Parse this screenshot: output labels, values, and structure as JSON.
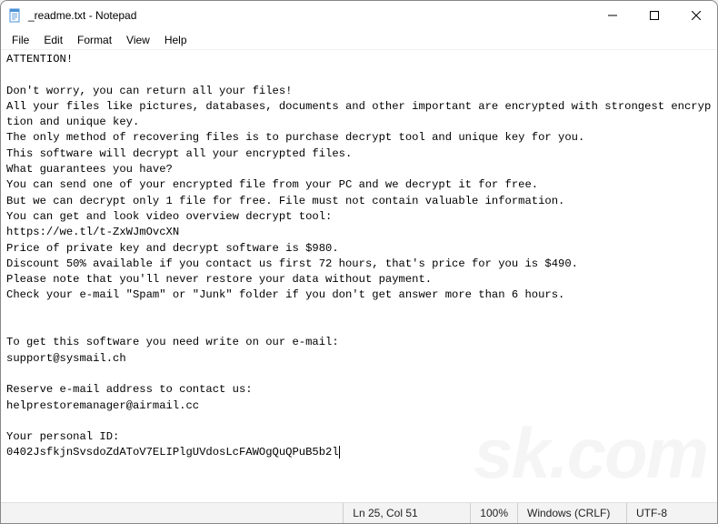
{
  "window": {
    "title": "_readme.txt - Notepad"
  },
  "menu": {
    "file": "File",
    "edit": "Edit",
    "format": "Format",
    "view": "View",
    "help": "Help"
  },
  "body_text": "ATTENTION!\n\nDon't worry, you can return all your files!\nAll your files like pictures, databases, documents and other important are encrypted with strongest encryption and unique key.\nThe only method of recovering files is to purchase decrypt tool and unique key for you.\nThis software will decrypt all your encrypted files.\nWhat guarantees you have?\nYou can send one of your encrypted file from your PC and we decrypt it for free.\nBut we can decrypt only 1 file for free. File must not contain valuable information.\nYou can get and look video overview decrypt tool:\nhttps://we.tl/t-ZxWJmOvcXN\nPrice of private key and decrypt software is $980.\nDiscount 50% available if you contact us first 72 hours, that's price for you is $490.\nPlease note that you'll never restore your data without payment.\nCheck your e-mail \"Spam\" or \"Junk\" folder if you don't get answer more than 6 hours.\n\n\nTo get this software you need write on our e-mail:\nsupport@sysmail.ch\n\nReserve e-mail address to contact us:\nhelprestoremanager@airmail.cc\n\nYour personal ID:\n0402JsfkjnSvsdoZdAToV7ELIPlgUVdosLcFAWOgQuQPuB5b2l",
  "status": {
    "position": "Ln 25, Col 51",
    "zoom": "100%",
    "line_ending": "Windows (CRLF)",
    "encoding": "UTF-8"
  },
  "watermark": "sk.com"
}
